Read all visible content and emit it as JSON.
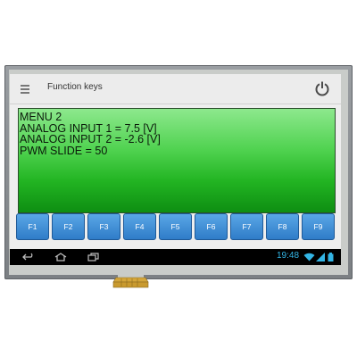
{
  "window": {
    "title": "Function keys"
  },
  "content": {
    "lines": [
      "MENU 2",
      "ANALOG INPUT 1 = 7.5 [V]",
      "ANALOG INPUT 2 = -2.6 [V]",
      "PWM SLIDE = 50"
    ]
  },
  "function_keys": [
    "F1",
    "F2",
    "F3",
    "F4",
    "F5",
    "F6",
    "F7",
    "F8",
    "F9"
  ],
  "status": {
    "time": "19:48"
  },
  "colors": {
    "accent": "#33b5e5",
    "button": "#3a8ad8",
    "screen_green": "#22b422"
  },
  "icons": [
    "menu-icon",
    "power-icon",
    "back-icon",
    "home-icon",
    "recent-apps-icon",
    "wifi-icon",
    "signal-icon",
    "battery-icon"
  ]
}
